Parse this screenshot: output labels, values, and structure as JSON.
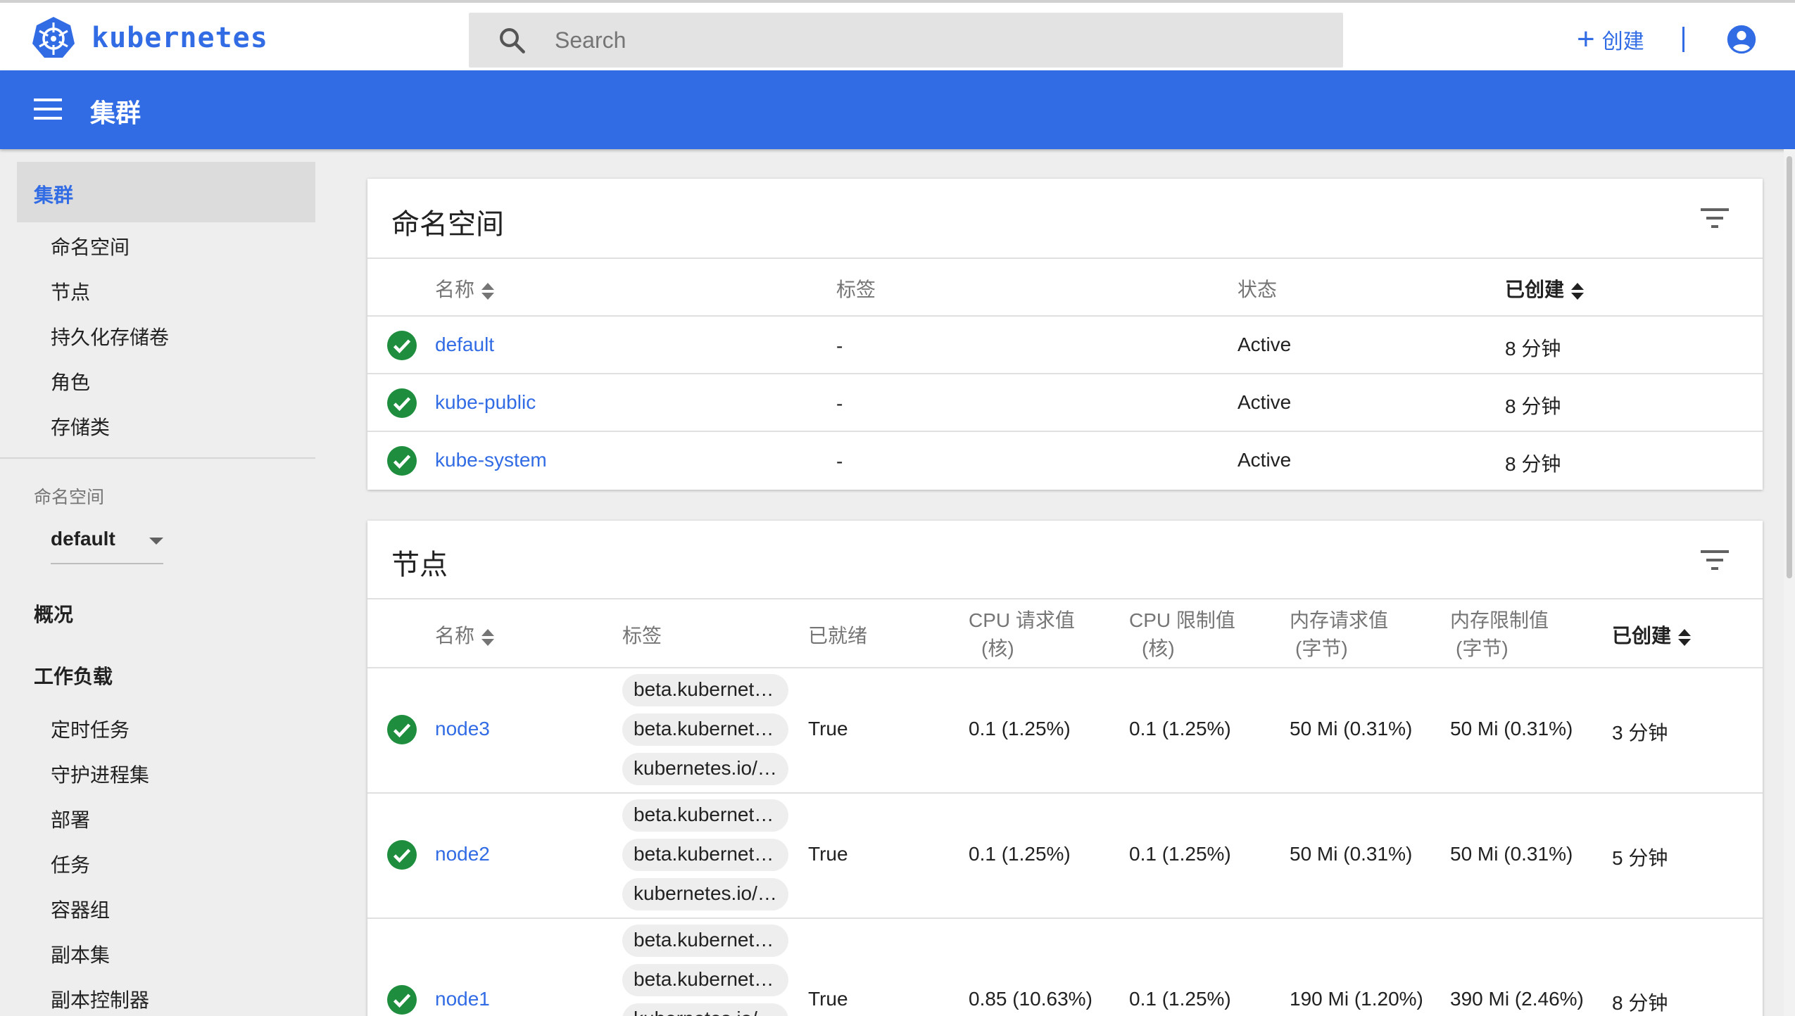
{
  "app": {
    "name": "kubernetes"
  },
  "search": {
    "placeholder": "Search"
  },
  "topbar": {
    "create_label": "创建"
  },
  "header": {
    "title": "集群"
  },
  "sidebar": {
    "active": "集群",
    "cluster_items": [
      "命名空间",
      "节点",
      "持久化存储卷",
      "角色",
      "存储类"
    ],
    "namespace_label": "命名空间",
    "namespace_value": "default",
    "overview": "概况",
    "workloads": "工作负载",
    "workload_items": [
      "定时任务",
      "守护进程集",
      "部署",
      "任务",
      "容器组",
      "副本集",
      "副本控制器"
    ]
  },
  "namespaces_card": {
    "title": "命名空间",
    "columns": [
      "名称",
      "标签",
      "状态",
      "已创建"
    ],
    "rows": [
      {
        "name": "default",
        "labels": "-",
        "status": "Active",
        "created": "8 分钟"
      },
      {
        "name": "kube-public",
        "labels": "-",
        "status": "Active",
        "created": "8 分钟"
      },
      {
        "name": "kube-system",
        "labels": "-",
        "status": "Active",
        "created": "8 分钟"
      }
    ]
  },
  "nodes_card": {
    "title": "节点",
    "columns": {
      "name": "名称",
      "labels": "标签",
      "ready": "已就绪",
      "cpu_req": [
        "CPU 请求值",
        "(核)"
      ],
      "cpu_lim": [
        "CPU 限制值",
        "(核)"
      ],
      "mem_req": [
        "内存请求值",
        "(字节)"
      ],
      "mem_lim": [
        "内存限制值",
        "(字节)"
      ],
      "created": "已创建"
    },
    "rows": [
      {
        "name": "node3",
        "labels": [
          "beta.kubernetes..",
          "beta.kubernetes..",
          "kubernetes.io/h..."
        ],
        "ready": "True",
        "cpu_req": "0.1 (1.25%)",
        "cpu_lim": "0.1 (1.25%)",
        "mem_req": "50 Mi (0.31%)",
        "mem_lim": "50 Mi (0.31%)",
        "created": "3 分钟"
      },
      {
        "name": "node2",
        "labels": [
          "beta.kubernetes..",
          "beta.kubernetes..",
          "kubernetes.io/h..."
        ],
        "ready": "True",
        "cpu_req": "0.1 (1.25%)",
        "cpu_lim": "0.1 (1.25%)",
        "mem_req": "50 Mi (0.31%)",
        "mem_lim": "50 Mi (0.31%)",
        "created": "5 分钟"
      },
      {
        "name": "node1",
        "labels": [
          "beta.kubernetes..",
          "beta.kubernetes..",
          "kubernetes.io/h..."
        ],
        "ready": "True",
        "cpu_req": "0.85 (10.63%)",
        "cpu_lim": "0.1 (1.25%)",
        "mem_req": "190 Mi (1.20%)",
        "mem_lim": "390 Mi (2.46%)",
        "created": "8 分钟"
      }
    ]
  },
  "colors": {
    "brand": "#326ce5",
    "ok": "#1e8e3e"
  }
}
